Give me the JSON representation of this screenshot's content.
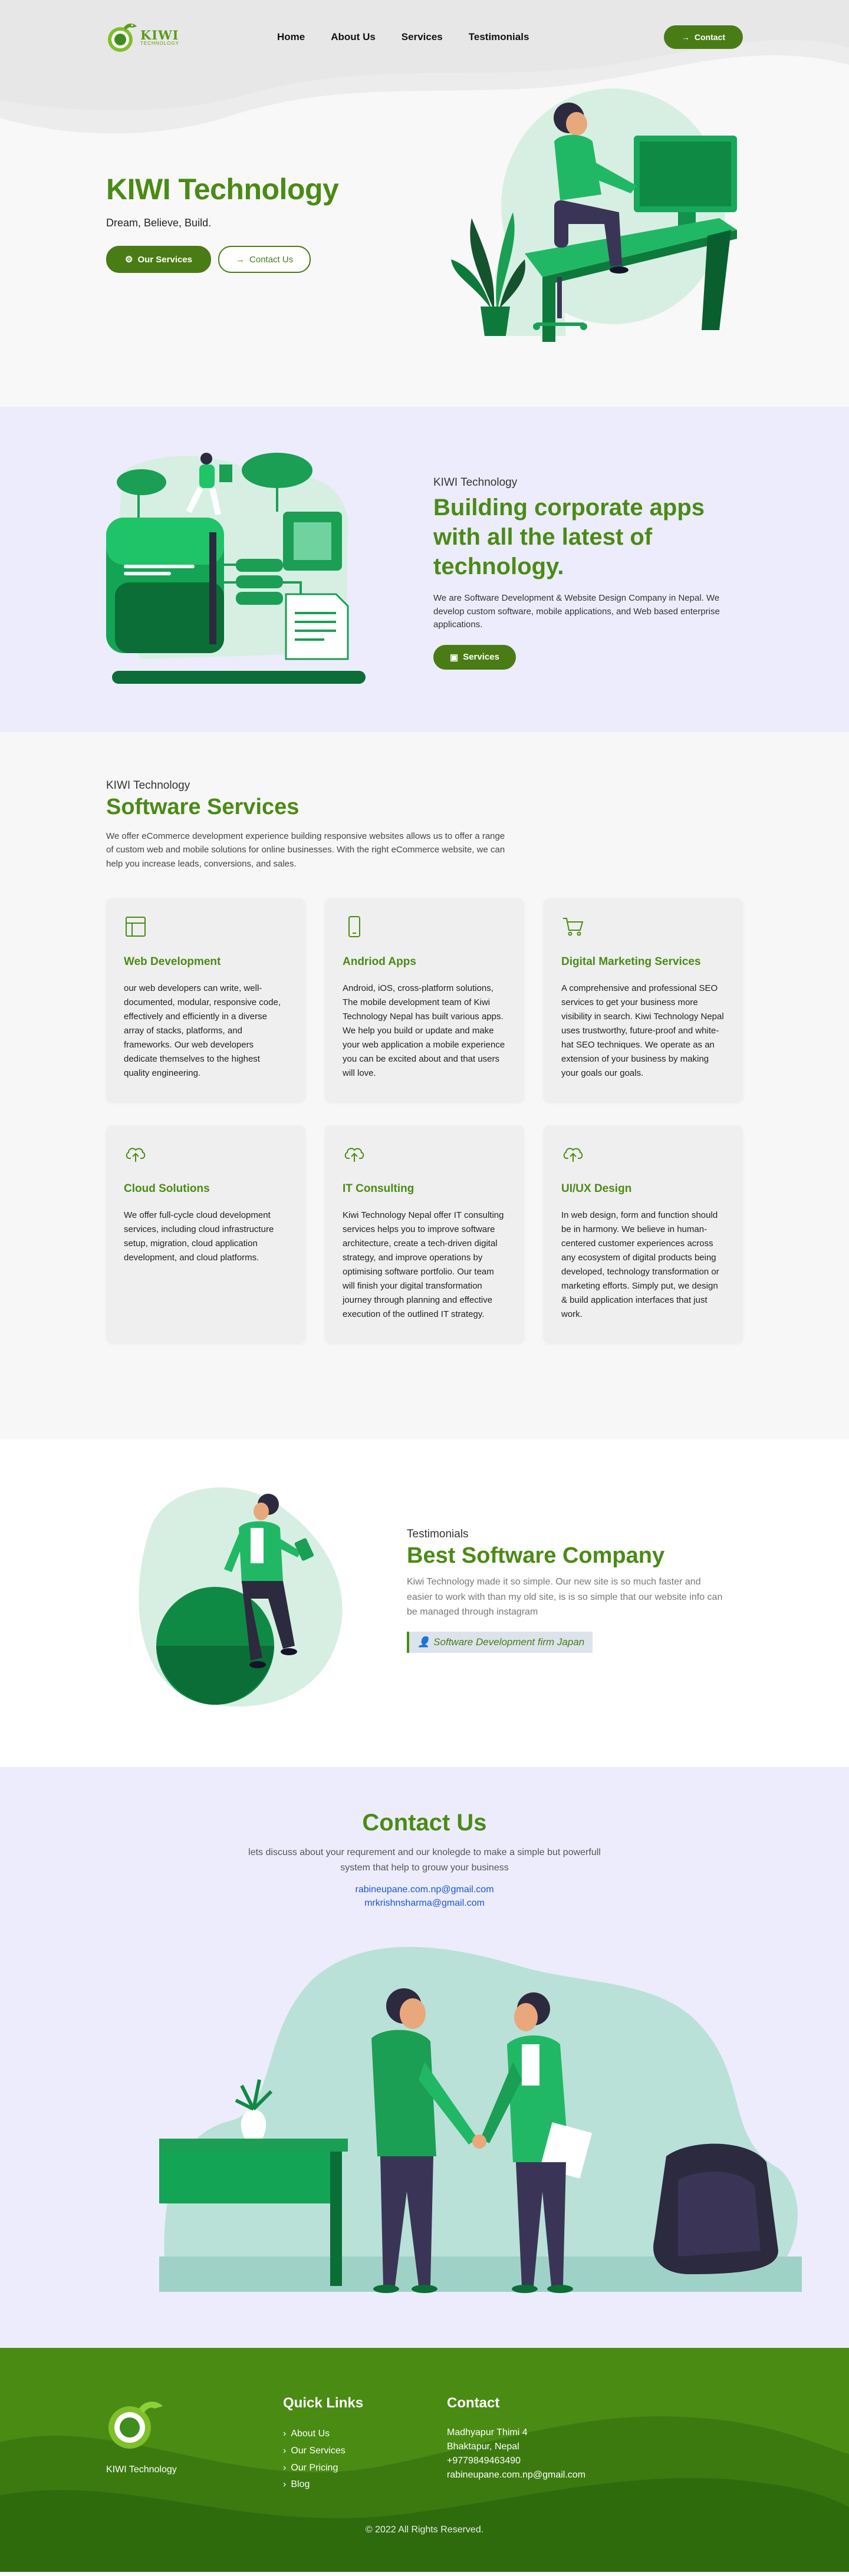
{
  "brand": {
    "logo_line1": "KIWI",
    "logo_line2": "TECHNOLOGY"
  },
  "nav": {
    "items": [
      "Home",
      "About Us",
      "Services",
      "Testimonials"
    ],
    "contact_label": "Contact"
  },
  "hero": {
    "title": "KIWI Technology",
    "subtitle": "Dream, Believe, Build.",
    "btn_services": "Our Services",
    "btn_contact": "Contact Us"
  },
  "about": {
    "eyebrow": "KIWI Technology",
    "title": "Building corporate apps with all the latest of technology.",
    "desc": "We are Software Development & Website Design Company in Nepal. We develop custom software, mobile applications, and Web based enterprise applications.",
    "button": "Services"
  },
  "services": {
    "eyebrow": "KIWI Technology",
    "title": "Software Services",
    "desc": "We offer eCommerce development experience building responsive websites allows us to offer a range of custom web and mobile solutions for online businesses. With the right eCommerce website, we can help you increase leads, conversions, and sales.",
    "cards": [
      {
        "icon": "layout-icon",
        "title": "Web Development",
        "text": "our web developers can write, well-documented, modular, responsive code, effectively and efficiently in a diverse array of stacks, platforms, and frameworks. Our web developers dedicate themselves to the highest quality engineering."
      },
      {
        "icon": "mobile-icon",
        "title": "Andriod Apps",
        "text": "Android, iOS, cross-platform solutions, The mobile development team of Kiwi Technology Nepal has built various apps. We help you build or update and make your web application a mobile experience you can be excited about and that users will love."
      },
      {
        "icon": "cart-icon",
        "title": "Digital Marketing Services",
        "text": "A comprehensive and professional SEO services to get your business more visibility in search. Kiwi Technology Nepal uses trustworthy, future-proof and white-hat SEO techniques. We operate as an extension of your business by making your goals our goals."
      },
      {
        "icon": "cloud-upload-icon",
        "title": "Cloud Solutions",
        "text": "We offer full-cycle cloud development services, including cloud infrastructure setup, migration, cloud application development, and cloud platforms."
      },
      {
        "icon": "cloud-upload-icon",
        "title": "IT Consulting",
        "text": "Kiwi Technology Nepal offer IT consulting services helps you to improve software architecture, create a tech-driven digital strategy, and improve operations by optimising software portfolio. Our team will finish your digital transformation journey through planning and effective execution of the outlined IT strategy."
      },
      {
        "icon": "cloud-upload-icon",
        "title": "UI/UX Design",
        "text": "In web design, form and function should be in harmony. We believe in human-centered customer experiences across any ecosystem of digital products being developed, technology transformation or marketing efforts. Simply put, we design & build application interfaces that just work."
      }
    ]
  },
  "testimonials": {
    "eyebrow": "Testimonials",
    "title": "Best Software Company",
    "desc": "Kiwi Technology made it so simple. Our new site is so much faster and easier to work with than my old site, is is so simple that our website info can be managed through instagram",
    "author": "Software Development firm Japan"
  },
  "contact": {
    "title": "Contact Us",
    "desc": "lets discuss about your requrement and our knolegde to make a simple but powerfull system that help to grouw your business",
    "emails": [
      "rabineupane.com.np@gmail.com",
      "mrkrishnsharma@gmail.com"
    ]
  },
  "footer": {
    "brand_name": "KIWI Technology",
    "quick_links_title": "Quick Links",
    "quick_links": [
      "About Us",
      "Our Services",
      "Our Pricing",
      "Blog"
    ],
    "contact_title": "Contact",
    "address": [
      "Madhyapur Thimi 4",
      "Bhaktapur, Nepal",
      "+9779849463490",
      "rabineupane.com.np@gmail.com"
    ],
    "copyright": "© 2022 All Rights Reserved."
  },
  "colors": {
    "brand_green": "#4a8b14",
    "button_green": "#4a7c16",
    "section_lavender": "#ececfc",
    "footer_green": "#2e6b0d",
    "link_blue": "#1a56d6"
  }
}
